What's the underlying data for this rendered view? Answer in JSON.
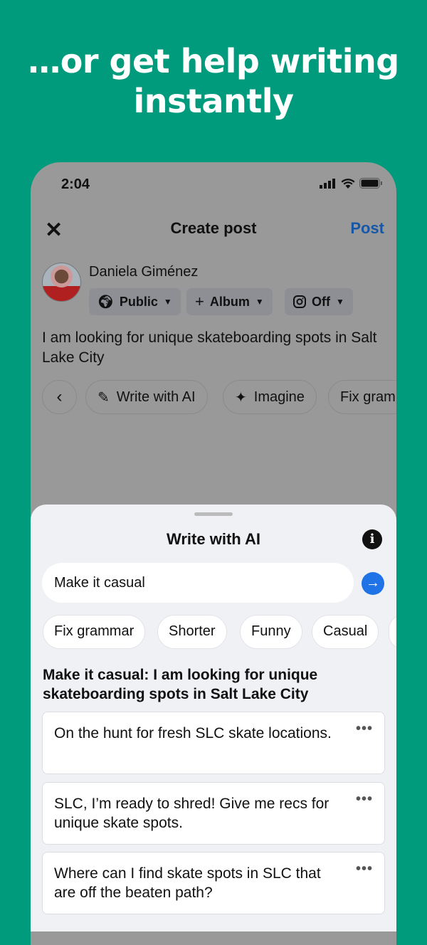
{
  "headline": "…or get help writing instantly",
  "status": {
    "time": "2:04",
    "icons": [
      "signal-icon",
      "wifi-icon",
      "battery-icon"
    ]
  },
  "header": {
    "close_icon": "close-icon",
    "title": "Create post",
    "post_label": "Post",
    "post_color": "#1657a8"
  },
  "author": {
    "name": "Daniela Giménez"
  },
  "audience": [
    {
      "icon": "globe-icon",
      "label": "Public"
    },
    {
      "icon": "plus-icon",
      "label": "Album"
    },
    {
      "icon": "instagram-icon",
      "label": "Off"
    }
  ],
  "post_text": "I am looking for unique skateboarding spots in Salt Lake City",
  "tools": [
    {
      "icon": "pencil-icon",
      "label": "Write with AI"
    },
    {
      "icon": "sparkles-icon",
      "label": "Imagine"
    },
    {
      "label": "Fix grammar"
    }
  ],
  "sheet": {
    "title": "Write with AI",
    "input_value": "Make it casual",
    "send_color": "#1f73e6",
    "suggestions": [
      "Fix grammar",
      "Shorter",
      "Funny",
      "Casual"
    ],
    "result_heading": "Make it casual: I am looking for unique skateboarding spots in Salt Lake City",
    "results": [
      "On the hunt for fresh SLC skate locations.",
      "SLC, I’m ready to shred! Give me recs for unique skate spots.",
      "Where can I find skate spots in SLC that are off the beaten path?"
    ],
    "more_label": "•••"
  },
  "colors": {
    "background": "#009b7d",
    "sheet": "#f0f1f5"
  }
}
